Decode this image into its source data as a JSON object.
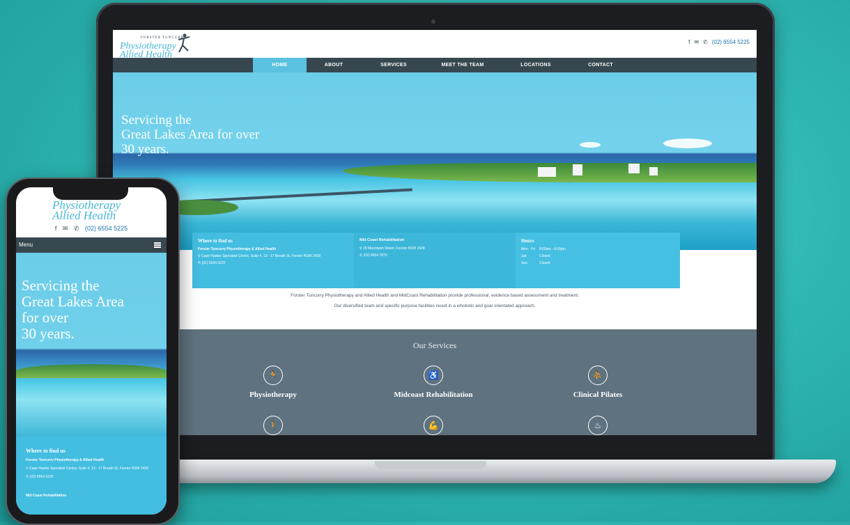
{
  "site": {
    "logo_line1": "Physiotherapy",
    "logo_line2": "Allied Health",
    "logo_small": "FORSTER TUNCURRY",
    "phone": "(02) 6554 5225"
  },
  "nav": {
    "items": [
      "HOME",
      "ABOUT",
      "SERVICES",
      "MEET THE TEAM",
      "LOCATIONS",
      "CONTACT"
    ]
  },
  "hero": {
    "title_line1": "Servicing the",
    "title_line2": "Great Lakes Area for over",
    "title_line3": "30 years."
  },
  "info": {
    "box1_title": "Where to find us",
    "box1_name": "Forster Tuncurry Physiotherapy & Allied Health",
    "box1_address": "Cape Hawke Specialist Centre, Suite 4, 13 - 17 Breath St, Forster NSW 2428",
    "box1_phone": "(02) 6554 5225",
    "box2_title": "Mid Coast Rehabilitation",
    "box2_address": "29 Macintosh Street, Forster NSW 2428",
    "box2_phone": "(02) 6554 7870",
    "box3_title": "Hours",
    "hours": [
      {
        "day": "Mon - Fri",
        "time": "8:00am - 6:00pm"
      },
      {
        "day": "Sat",
        "time": "Closed"
      },
      {
        "day": "Sun",
        "time": "Closed"
      }
    ]
  },
  "intro": {
    "line1": "Forster Tuncurry Physiotherapy and Allied Health and MidCoast Rehabilitation provide professional, evidence based assessment and treatment.",
    "line2": "Our diversified team and specific purpose facilities result in a wholistic and goal orientated approach."
  },
  "services": {
    "heading": "Our Services",
    "items": [
      "Physiotherapy",
      "Midcoast Rehabilitation",
      "Clinical Pilates"
    ]
  },
  "mobile": {
    "menu_label": "Menu",
    "hero_line1": "Servicing the",
    "hero_line2": "Great Lakes Area",
    "hero_line3": "for over",
    "hero_line4": "30 years.",
    "info_title": "Where to find us",
    "info_name": "Forster Tuncurry Physiotherapy & Allied Health",
    "info_address": "Cape Hawke Specialist Centre, Suite 4, 13 - 17 Breath St, Forster NSW 2428",
    "info_phone": "(02) 6554 5225",
    "info_sub": "Mid Coast Rehabilitation"
  },
  "icons": {
    "facebook": "facebook-icon",
    "email": "email-icon",
    "phone": "phone-icon",
    "menu": "hamburger-icon"
  },
  "colors": {
    "accent": "#5ac2e0",
    "nav_bg": "#37474f",
    "services_bg": "#5f727f",
    "info_bg": "#43bde0"
  }
}
